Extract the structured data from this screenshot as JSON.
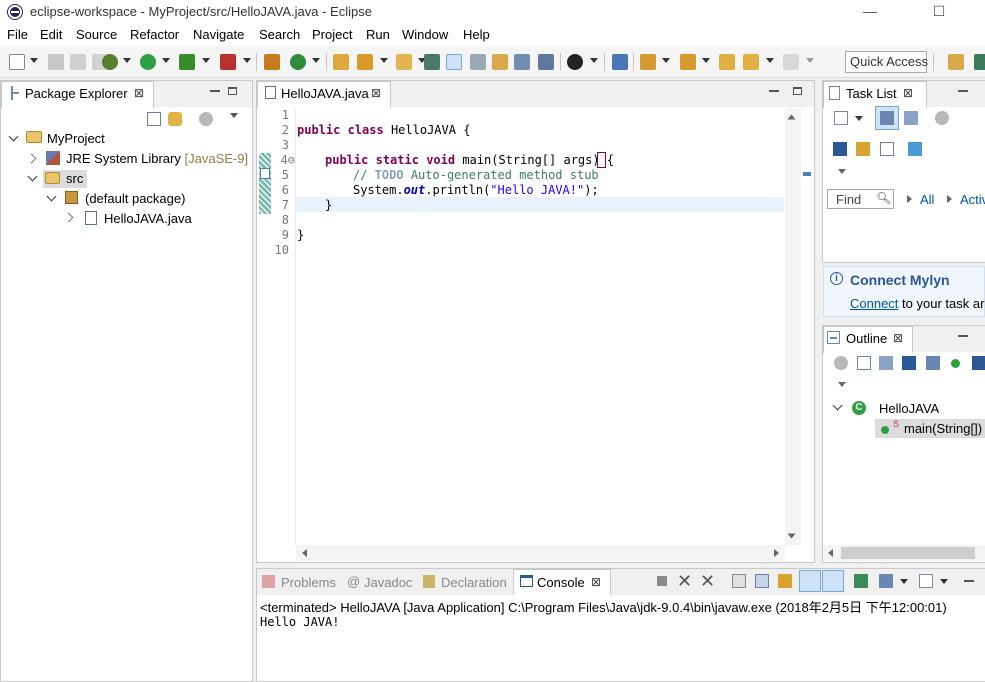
{
  "window": {
    "title": "eclipse-workspace - MyProject/src/HelloJAVA.java - Eclipse",
    "minimize": "—",
    "maximize": "☐",
    "close": "✕"
  },
  "menubar": {
    "items": [
      "File",
      "Edit",
      "Source",
      "Refactor",
      "Navigate",
      "Search",
      "Project",
      "Run",
      "Window",
      "Help"
    ]
  },
  "toolbar": {
    "quick_access": "Quick Access"
  },
  "package_explorer": {
    "title": "Package Explorer",
    "close": "⊠",
    "tree": {
      "project": "MyProject",
      "jre_label": "JRE System Library",
      "jre_version": "[JavaSE-9]",
      "src": "src",
      "default_package": "(default package)",
      "file": "HelloJAVA.java"
    }
  },
  "editor": {
    "tab_label": "HelloJAVA.java",
    "close": "⊠",
    "line_numbers": [
      "1",
      "2",
      "3",
      "4⊖",
      "5",
      "6",
      "7",
      "8",
      "9",
      "10"
    ],
    "code": {
      "l2_kw1": "public",
      "l2_kw2": "class",
      "l2_rest": " HelloJAVA {",
      "l4_kw1": "public",
      "l4_kw2": "static",
      "l4_kw3": "void",
      "l4_rest": " main(String[] args) {",
      "l5_comment": "// ",
      "l5_todo": "TODO",
      "l5_comment_rest": " Auto-generated method stub",
      "l6_a": "System.",
      "l6_field": "out",
      "l6_b": ".println(",
      "l6_str": "\"Hello JAVA!\"",
      "l6_c": ");",
      "l7": "}",
      "l9": "}"
    }
  },
  "task_list": {
    "title": "Task List",
    "close": "⊠",
    "find_placeholder": "Find",
    "filter_all": "All",
    "filter_active": "Activ"
  },
  "mylyn": {
    "title": "Connect Mylyn",
    "link": "Connect",
    "text": " to your task ar"
  },
  "outline": {
    "title": "Outline",
    "close": "⊠",
    "class_name": "HelloJAVA",
    "method": "main(String[])"
  },
  "bottom_tabs": {
    "problems": "Problems",
    "javadoc": "Javadoc",
    "declaration": "Declaration",
    "console": "Console",
    "close": "⊠"
  },
  "console": {
    "status": "<terminated> HelloJAVA [Java Application] C:\\Program Files\\Java\\jdk-9.0.4\\bin\\javaw.exe (2018年2月5日 下午12:00:01)",
    "output": "Hello JAVA!"
  },
  "colors": {
    "keyword": "#7f0055",
    "comment": "#3f7f5f",
    "string": "#2a00ff",
    "link": "#0056a8",
    "current_line": "#e8f2fe"
  }
}
